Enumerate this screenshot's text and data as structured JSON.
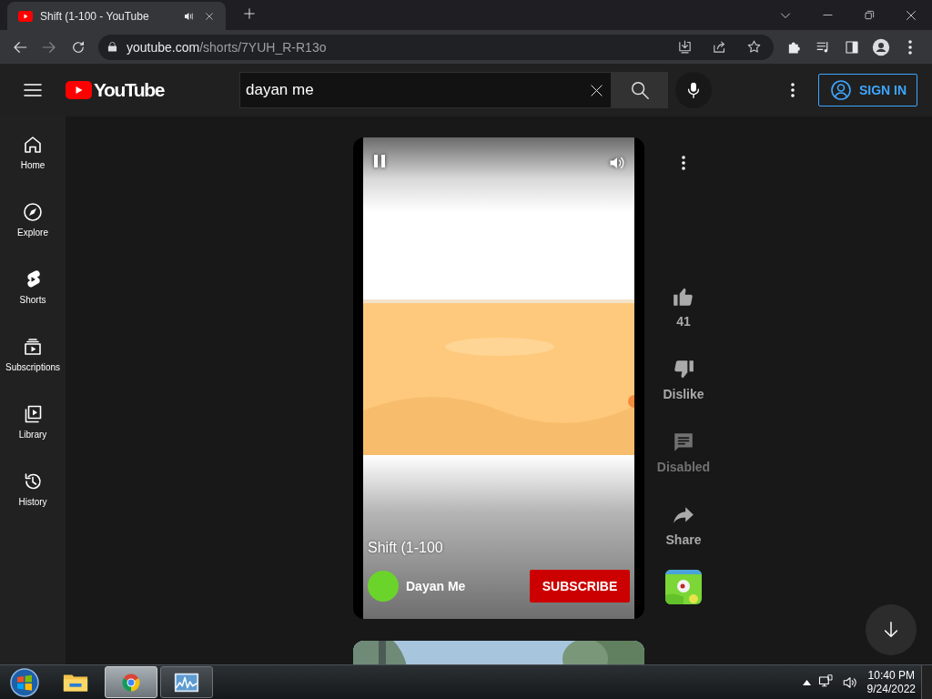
{
  "browser": {
    "tabs": [
      {
        "title": "Shift (1-100 - YouTube",
        "selected": true,
        "audio": true
      }
    ],
    "url": {
      "host": "youtube.com",
      "path": "/shorts/7YUH_R-R13o"
    }
  },
  "header": {
    "logo_text": "YouTube",
    "search": {
      "value": "dayan me"
    },
    "sign_in": "SIGN IN"
  },
  "sidebar": {
    "items": [
      {
        "label": "Home",
        "kind": "home"
      },
      {
        "label": "Explore",
        "kind": "explore"
      },
      {
        "label": "Shorts",
        "kind": "shorts"
      },
      {
        "label": "Subscriptions",
        "kind": "subscriptions"
      },
      {
        "label": "Library",
        "kind": "library"
      },
      {
        "label": "History",
        "kind": "history"
      }
    ]
  },
  "short": {
    "title": "Shift (1-100",
    "channel": "Dayan Me",
    "subscribe": "SUBSCRIBE"
  },
  "actions": [
    {
      "kind": "like",
      "label": "41",
      "disabled": false
    },
    {
      "kind": "dislike",
      "label": "Dislike",
      "disabled": false
    },
    {
      "kind": "comments",
      "label": "Disabled",
      "disabled": true
    },
    {
      "kind": "share",
      "label": "Share",
      "disabled": false
    }
  ],
  "taskbar": {
    "apps": [
      {
        "kind": "explorer",
        "running": false,
        "selected": false
      },
      {
        "kind": "chrome",
        "running": true,
        "selected": true
      },
      {
        "kind": "monitor",
        "running": true,
        "selected": false
      }
    ],
    "time": "10:40 PM",
    "date": "9/24/2022"
  }
}
